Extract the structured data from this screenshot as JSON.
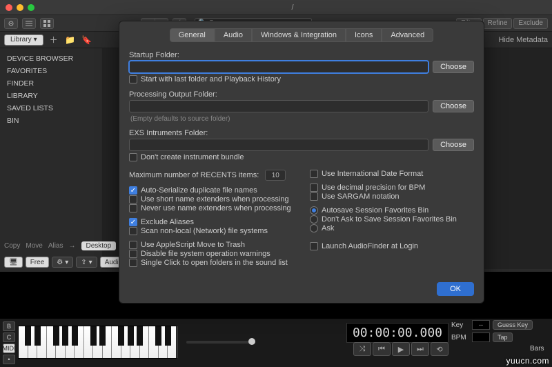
{
  "window": {
    "title": "/"
  },
  "toolbar": {
    "search_placeholder": "Q-",
    "filter": "Filter",
    "refine": "Refine",
    "exclude": "Exclude"
  },
  "topbar": {
    "library": "Library",
    "hide_metadata": "Hide Metadata"
  },
  "sidebar": {
    "items": [
      "DEVICE BROWSER",
      "FAVORITES",
      "FINDER",
      "LIBRARY",
      "SAVED LISTS",
      "BIN"
    ]
  },
  "actions": {
    "copy": "Copy",
    "move": "Move",
    "alias": "Alias",
    "desktop": "Desktop"
  },
  "chips": {
    "free": "Free",
    "audio": "Audio U"
  },
  "clock": "00:00:00.000",
  "ctl": {
    "key_label": "Key",
    "key_val": "--",
    "guess": "Guess Key",
    "bpm_label": "BPM",
    "bpm_val": "",
    "tap": "Tap",
    "bars_label": "Bars"
  },
  "bottom": {
    "b": "B",
    "c": "C",
    "midi": "MIDI"
  },
  "prefs": {
    "tabs": [
      "General",
      "Audio",
      "Windows & Integration",
      "Icons",
      "Advanced"
    ],
    "selected_tab": 0,
    "startup_label": "Startup Folder:",
    "startup_value": "",
    "choose": "Choose",
    "start_with_last": "Start with last folder and Playback History",
    "proc_label": "Processing Output Folder:",
    "proc_value": "",
    "proc_note": "(Empty defaults to source folder)",
    "exs_label": "EXS Intruments Folder:",
    "exs_value": "",
    "dont_bundle": "Don't create instrument bundle",
    "recents_label": "Maximum number of RECENTS items:",
    "recents_value": "10",
    "left_checks": [
      {
        "label": "Auto-Serialize duplicate file names",
        "on": true
      },
      {
        "label": "Use short name extenders when processing",
        "on": false
      },
      {
        "label": "Never use name extenders when processing",
        "on": false
      }
    ],
    "left_excl": {
      "label": "Exclude Aliases",
      "on": true
    },
    "left_scan": {
      "label": "Scan non-local (Network) file systems",
      "on": false
    },
    "left_more": [
      {
        "label": "Use AppleScript Move to Trash",
        "on": false
      },
      {
        "label": "Disable file system operation warnings",
        "on": false
      },
      {
        "label": "Single Click to open folders in the sound list",
        "on": false
      }
    ],
    "right_top": [
      {
        "label": "Use International Date Format",
        "on": false
      },
      {
        "label": "Use decimal precision for BPM",
        "on": false
      },
      {
        "label": "Use SARGAM notation",
        "on": false
      }
    ],
    "radios": [
      {
        "label": "Autosave Session Favorites Bin",
        "on": true
      },
      {
        "label": "Don't Ask to Save Session Favorites Bin",
        "on": false
      },
      {
        "label": "Ask",
        "on": false
      }
    ],
    "launch": {
      "label": "Launch AudioFinder at Login",
      "on": false
    },
    "ok": "OK"
  },
  "watermark": "yuucn.com"
}
